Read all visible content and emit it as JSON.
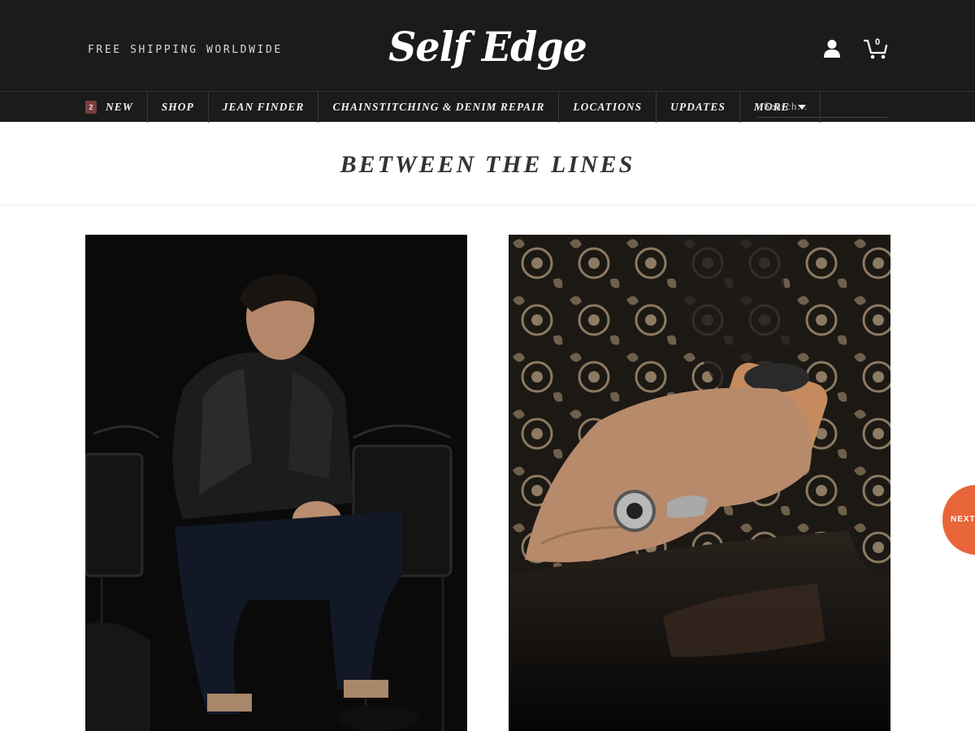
{
  "header": {
    "promo": "FREE SHIPPING WORLDWIDE",
    "logo_text": "Self Edge",
    "cart_count": "0"
  },
  "nav": {
    "new_badge": "2",
    "items": [
      "NEW",
      "SHOP",
      "JEAN FINDER",
      "CHAINSTITCHING & DENIM REPAIR",
      "LOCATIONS",
      "UPDATES",
      "MORE"
    ],
    "search_placeholder": "Search..."
  },
  "page": {
    "title": "BETWEEN THE LINES"
  },
  "next_button": "NEXT",
  "icons": {
    "account": "user-icon",
    "cart": "cart-icon",
    "more": "chevron-down-icon"
  },
  "colors": {
    "header_bg": "#1b1b1b",
    "badge": "#7a3e3e",
    "next_button": "#e8653a"
  }
}
